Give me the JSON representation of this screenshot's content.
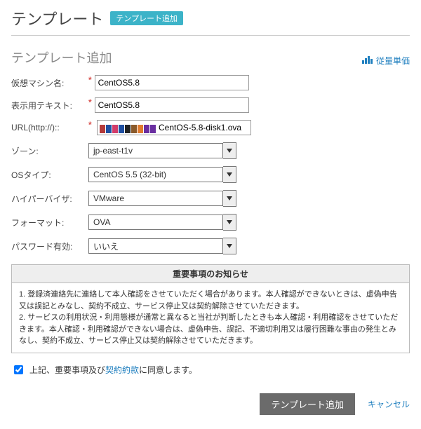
{
  "header": {
    "title": "テンプレート",
    "add_tag": "テンプレート追加"
  },
  "subheader": {
    "title": "テンプレート追加",
    "metered_label": "従量単価"
  },
  "form": {
    "vm_name": {
      "label": "仮想マシン名:",
      "value": "CentOS5.8",
      "required": true
    },
    "display_text": {
      "label": "表示用テキスト:",
      "value": "CentOS5.8",
      "required": true
    },
    "url": {
      "label": "URL(http://)::",
      "value": "CentOS-5.8-disk1.ova",
      "required": true
    },
    "zone": {
      "label": "ゾーン:",
      "value": "jp-east-t1v"
    },
    "os_type": {
      "label": "OSタイプ:",
      "value": "CentOS 5.5 (32-bit)"
    },
    "hypervisor": {
      "label": "ハイパーバイザ:",
      "value": "VMware"
    },
    "format": {
      "label": "フォーマット:",
      "value": "OVA"
    },
    "password": {
      "label": "パスワード有効:",
      "value": "いいえ"
    }
  },
  "notice": {
    "title": "重要事項のお知らせ",
    "line1": "1. 登録済連絡先に連絡して本人確認をさせていただく場合があります。本人確認ができないときは、虚偽申告又は誤記とみなし、契約不成立、サービス停止又は契約解除させていただきます。",
    "line2": "2. サービスの利用状況・利用態様が通常と異なると当社が判断したときも本人確認・利用確認をさせていただきます。本人確認・利用確認ができない場合は、虚偽申告、誤記、不適切利用又は履行困難な事由の発生とみなし、契約不成立、サービス停止又は契約解除させていただきます。"
  },
  "agree": {
    "prefix": "上記、重要事項及び",
    "link": "契約約款",
    "suffix": "に同意します。"
  },
  "actions": {
    "submit": "テンプレート追加",
    "cancel": "キャンセル"
  },
  "url_mask_colors": [
    "#b33a3a",
    "#1f4fa1",
    "#d23c6a",
    "#1f4fa1",
    "#222",
    "#8a5a2b",
    "#e07b2e",
    "#6a2fa0",
    "#6a2fa0"
  ]
}
